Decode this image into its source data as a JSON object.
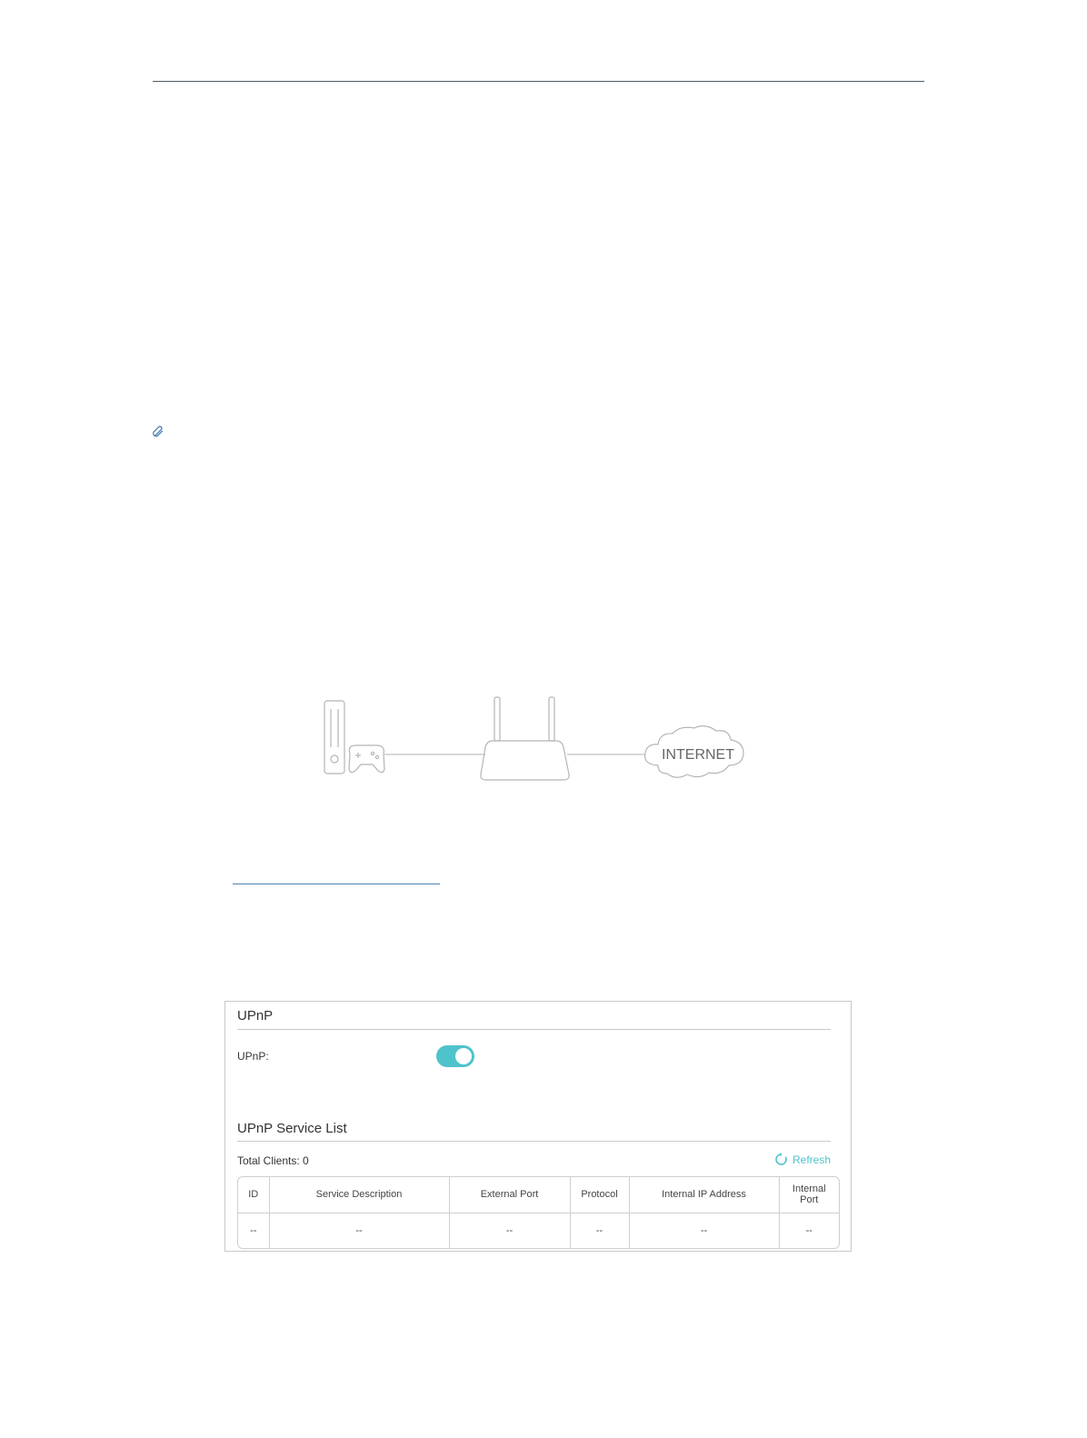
{
  "diagram": {
    "cloud_label": "INTERNET"
  },
  "upnp_panel": {
    "title": "UPnP",
    "upnp_label": "UPnP:",
    "upnp_enabled": true,
    "service_list_title": "UPnP Service List",
    "total_clients": "Total Clients: 0",
    "refresh_label": "Refresh",
    "table": {
      "headers": [
        "ID",
        "Service Description",
        "External Port",
        "Protocol",
        "Internal IP Address",
        "Internal Port"
      ],
      "rows": [
        [
          "--",
          "--",
          "--",
          "--",
          "--",
          "--"
        ]
      ]
    }
  },
  "colors": {
    "accent": "#4fc3cc",
    "rule": "#4a5a6a",
    "link": "#4c7fb0"
  }
}
